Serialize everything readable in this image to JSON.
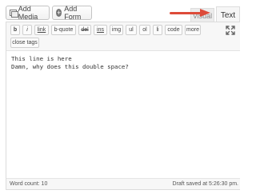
{
  "media_buttons": {
    "add_media": "Add Media",
    "add_form": "Add Form"
  },
  "tabs": {
    "visual": "Visual",
    "text": "Text",
    "active": "text"
  },
  "toolbar": {
    "buttons": [
      "b",
      "i",
      "link",
      "b-quote",
      "del",
      "ins",
      "img",
      "ul",
      "ol",
      "li",
      "code",
      "more",
      "close tags"
    ]
  },
  "content": {
    "lines": [
      "This line is here",
      "Damn, why does this double space?"
    ]
  },
  "status": {
    "word_count": "Word count: 10",
    "draft_saved": "Draft saved at 5:26:30 pm."
  },
  "colors": {
    "annotation_arrow": "#dd4b39"
  },
  "icons": {
    "add_media": "media-icon",
    "add_form": "form-icon",
    "fullscreen": "expand-icon"
  }
}
